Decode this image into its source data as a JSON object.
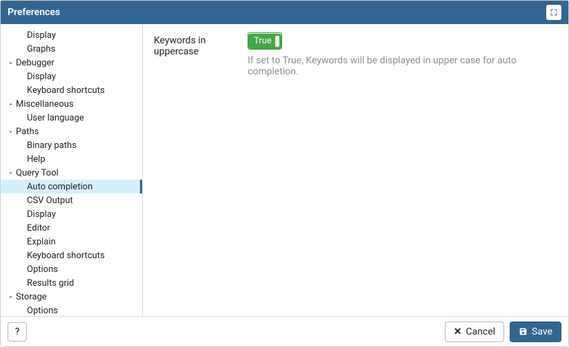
{
  "titlebar": {
    "title": "Preferences"
  },
  "sidebar": {
    "items": [
      {
        "type": "leaf",
        "label": "Display"
      },
      {
        "type": "leaf",
        "label": "Graphs"
      },
      {
        "type": "group",
        "label": "Debugger"
      },
      {
        "type": "leaf",
        "label": "Display"
      },
      {
        "type": "leaf",
        "label": "Keyboard shortcuts"
      },
      {
        "type": "group",
        "label": "Miscellaneous"
      },
      {
        "type": "leaf",
        "label": "User language"
      },
      {
        "type": "group",
        "label": "Paths"
      },
      {
        "type": "leaf",
        "label": "Binary paths"
      },
      {
        "type": "leaf",
        "label": "Help"
      },
      {
        "type": "group",
        "label": "Query Tool"
      },
      {
        "type": "leaf",
        "label": "Auto completion",
        "selected": true
      },
      {
        "type": "leaf",
        "label": "CSV Output"
      },
      {
        "type": "leaf",
        "label": "Display"
      },
      {
        "type": "leaf",
        "label": "Editor"
      },
      {
        "type": "leaf",
        "label": "Explain"
      },
      {
        "type": "leaf",
        "label": "Keyboard shortcuts"
      },
      {
        "type": "leaf",
        "label": "Options"
      },
      {
        "type": "leaf",
        "label": "Results grid"
      },
      {
        "type": "group",
        "label": "Storage"
      },
      {
        "type": "leaf",
        "label": "Options"
      }
    ]
  },
  "content": {
    "setting_label": "Keywords in uppercase",
    "toggle_value": "True",
    "help_text": "If set to True, Keywords will be displayed in upper case for auto completion."
  },
  "footer": {
    "help_label": "?",
    "cancel_label": "Cancel",
    "save_label": "Save"
  }
}
